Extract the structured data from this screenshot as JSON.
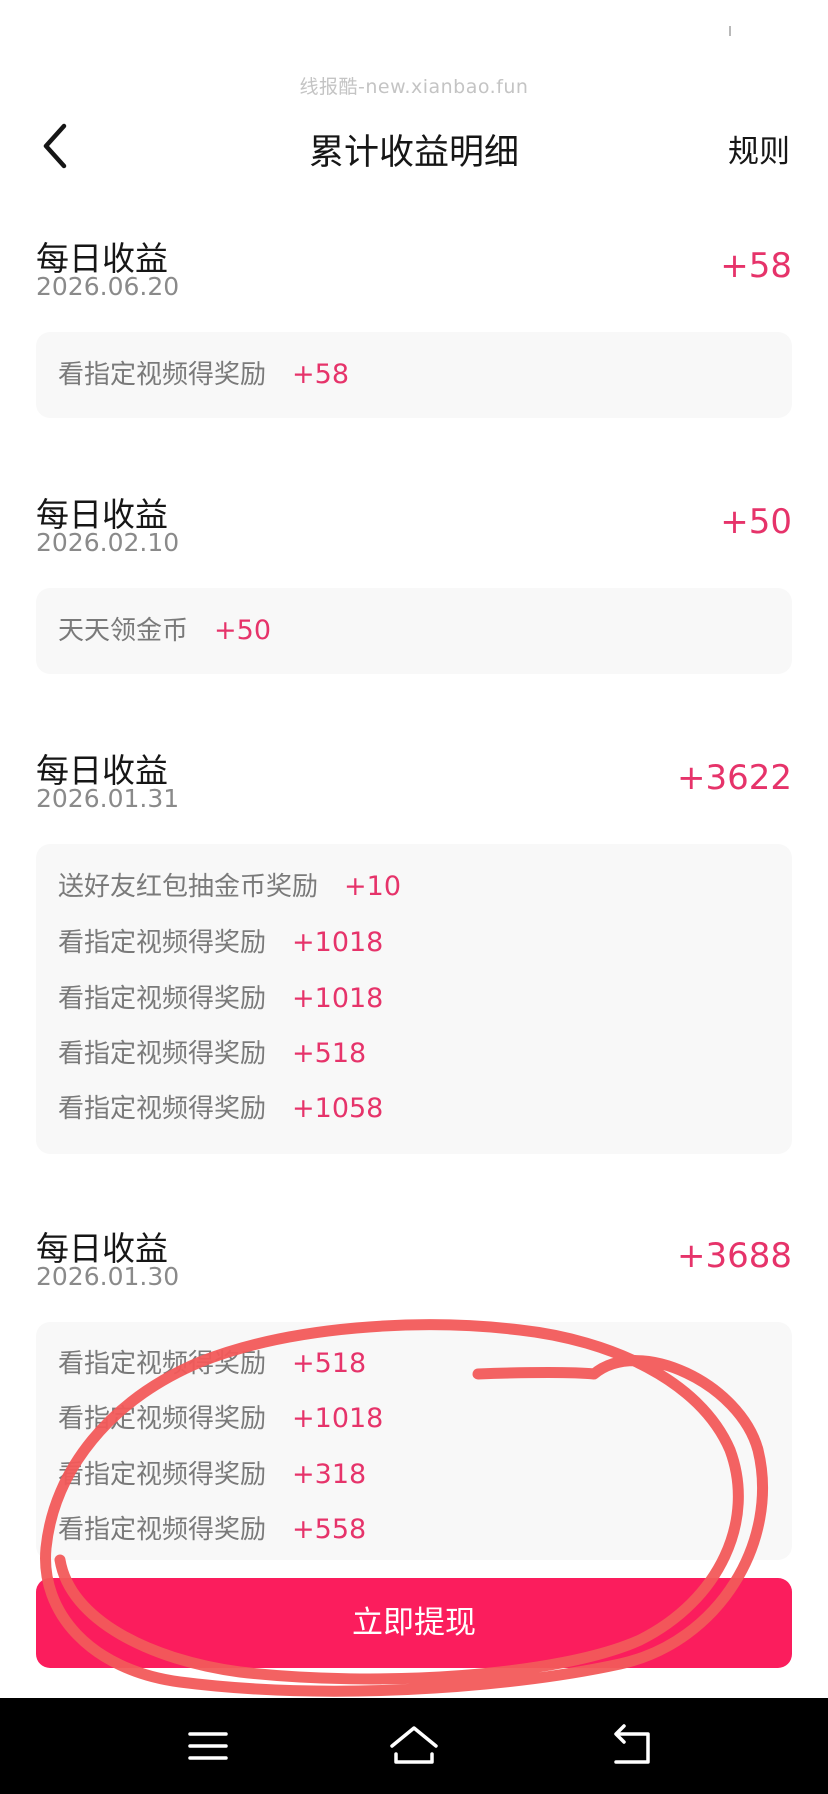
{
  "watermark": "线报酷-new.xianbao.fun",
  "header": {
    "title": "累计收益明细",
    "rules_label": "规则"
  },
  "sections": [
    {
      "title": "每日收益",
      "date": "2026.06.20",
      "total": "+58",
      "entries": [
        {
          "label": "看指定视频得奖励",
          "amount": "+58"
        }
      ]
    },
    {
      "title": "每日收益",
      "date": "2026.02.10",
      "total": "+50",
      "entries": [
        {
          "label": "天天领金币",
          "amount": "+50"
        }
      ]
    },
    {
      "title": "每日收益",
      "date": "2026.01.31",
      "total": "+3622",
      "entries": [
        {
          "label": "送好友红包抽金币奖励",
          "amount": "+10"
        },
        {
          "label": "看指定视频得奖励",
          "amount": "+1018"
        },
        {
          "label": "看指定视频得奖励",
          "amount": "+1018"
        },
        {
          "label": "看指定视频得奖励",
          "amount": "+518"
        },
        {
          "label": "看指定视频得奖励",
          "amount": "+1058"
        }
      ]
    },
    {
      "title": "每日收益",
      "date": "2026.01.30",
      "total": "+3688",
      "entries": [
        {
          "label": "看指定视频得奖励",
          "amount": "+518"
        },
        {
          "label": "看指定视频得奖励",
          "amount": "+1018"
        },
        {
          "label": "看指定视频得奖励",
          "amount": "+318"
        },
        {
          "label": "看指定视频得奖励",
          "amount": "+558"
        }
      ]
    }
  ],
  "withdraw_button": "立即提现",
  "colors": {
    "accent": "#fb1d5d",
    "amount": "#e6336a",
    "annotation": "#f25a5a"
  },
  "icons": {
    "back": "chevron-left-icon",
    "nav_menu": "menu-icon",
    "nav_home": "home-icon",
    "nav_back": "back-arrow-icon"
  }
}
